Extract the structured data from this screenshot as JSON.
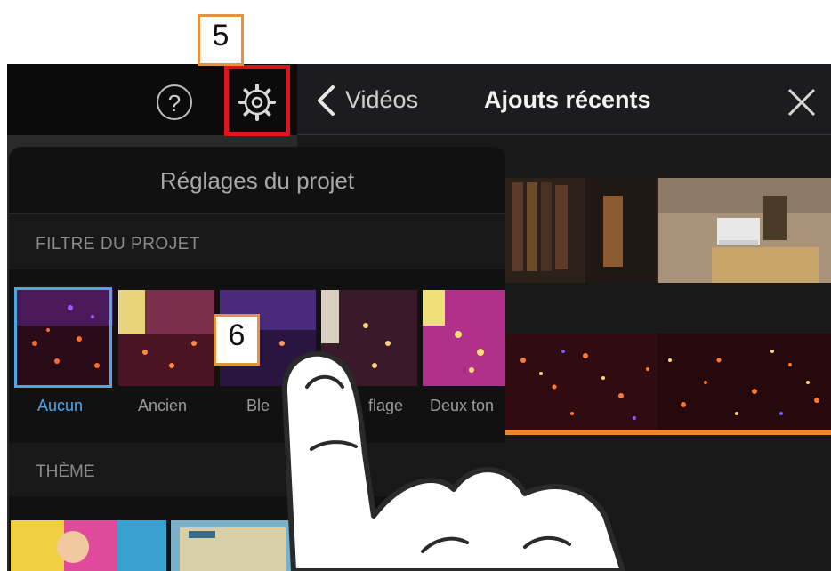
{
  "callouts": {
    "gear_step": "5",
    "filter_step": "6"
  },
  "toolbar": {
    "help_label": "?"
  },
  "nav": {
    "back_label": "Vidéos",
    "title": "Ajouts récents"
  },
  "panel": {
    "title": "Réglages du projet",
    "filter_header": "FILTRE DU PROJET",
    "filters": [
      {
        "label": "Aucun",
        "selected": true
      },
      {
        "label": "Ancien",
        "selected": false
      },
      {
        "label": "Ble",
        "selected": false
      },
      {
        "label": "flage",
        "selected": false
      },
      {
        "label": "Deux ton",
        "selected": false
      }
    ],
    "theme_header": "THÈME"
  },
  "colors": {
    "accent_selected": "#4ca7e8",
    "highlight_red": "#e0141a",
    "callout_orange": "#e8913f",
    "timeline_orange": "#f08a1e"
  },
  "icons": [
    "gear-icon",
    "help-icon",
    "back-chevron-icon",
    "close-icon"
  ]
}
